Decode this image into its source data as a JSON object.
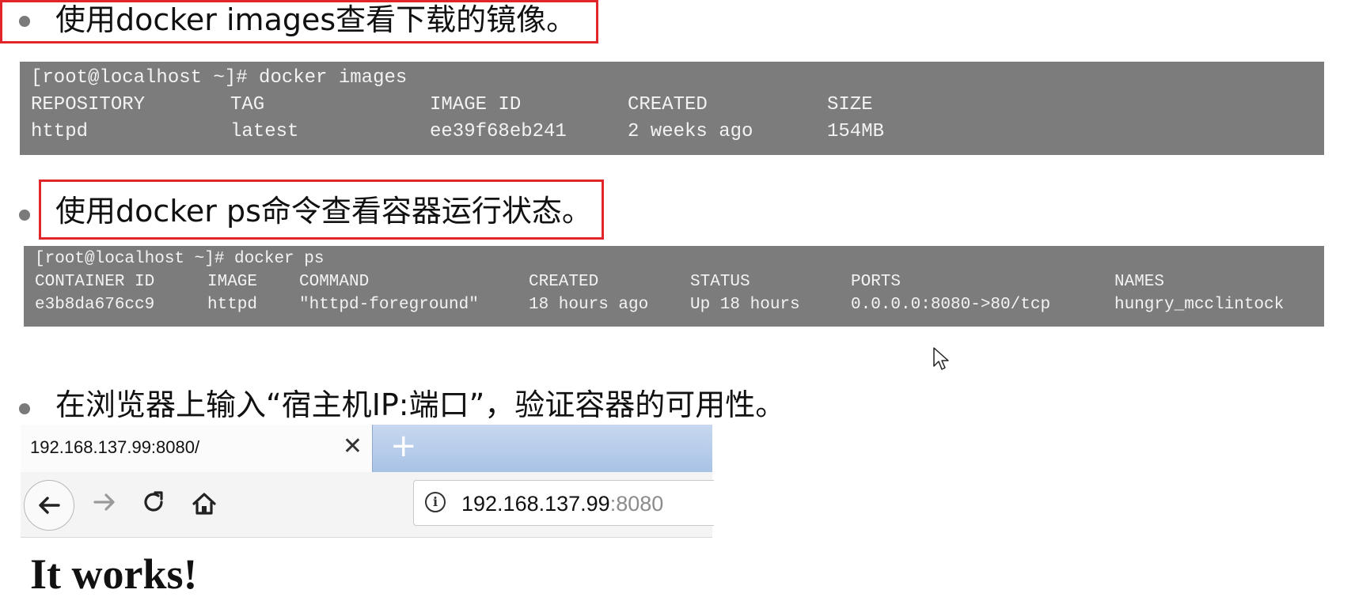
{
  "sections": [
    {
      "text": "使用docker images查看下载的镜像。"
    },
    {
      "text": "使用docker ps命令查看容器运行状态。"
    },
    {
      "text": "在浏览器上输入“宿主机IP:端口”，验证容器的可用性。"
    }
  ],
  "terminal1": {
    "prompt": "[root@localhost ~]# docker images",
    "headers": [
      "REPOSITORY",
      "TAG",
      "IMAGE ID",
      "CREATED",
      "SIZE"
    ],
    "row": [
      "httpd",
      "latest",
      "ee39f68eb241",
      "2 weeks ago",
      "154MB"
    ]
  },
  "terminal2": {
    "prompt": "[root@localhost ~]# docker ps",
    "headers": [
      "CONTAINER ID",
      "IMAGE",
      "COMMAND",
      "CREATED",
      "STATUS",
      "PORTS",
      "NAMES"
    ],
    "row": [
      "e3b8da676cc9",
      "httpd",
      "\"httpd-foreground\"",
      "18 hours ago",
      "Up 18 hours",
      "0.0.0.0:8080->80/tcp",
      "hungry_mcclintock"
    ]
  },
  "browser": {
    "tab_title": "192.168.137.99:8080/",
    "tab_close": "✕",
    "new_tab": "+",
    "url_host": "192.168.137.99",
    "url_port": ":8080",
    "page_heading": "It works!"
  },
  "icons": {
    "back": "back-arrow-icon",
    "forward": "forward-arrow-icon",
    "reload": "reload-icon",
    "home": "home-icon",
    "info": "info-icon",
    "cursor": "mouse-cursor-icon"
  },
  "colors": {
    "highlight_border": "#e0252b",
    "terminal_bg": "#7c7c7c",
    "terminal_text": "#f3f3f3"
  }
}
